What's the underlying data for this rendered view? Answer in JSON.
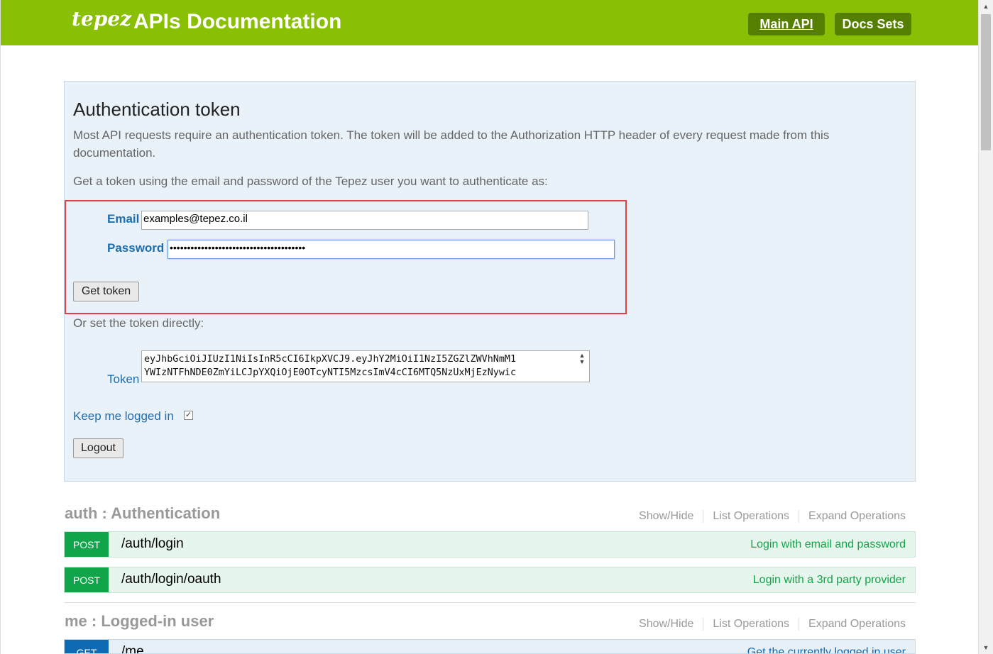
{
  "header": {
    "logo": "tepez",
    "title": "APIs Documentation",
    "main_api": "Main API",
    "docs_sets": "Docs Sets",
    "bg_color": "#89bf04"
  },
  "auth": {
    "title": "Authentication token",
    "description": "Most API requests require an authentication token. The token will be added to the Authorization HTTP header of every request made from this documentation.",
    "prompt": "Get a token using the email and password of the Tepez user you want to authenticate as:",
    "email_label": "Email",
    "email_value": "examples@tepez.co.il",
    "password_label": "Password",
    "password_value": "•••••••••••••••••••••••••••••••••••••••",
    "get_token": "Get token",
    "or_set": "Or set the token directly:",
    "token_label": "Token",
    "token_value": "eyJhbGciOiJIUzI1NiIsInR5cCI6IkpXVCJ9.eyJhY2MiOiI1NzI5ZGZlZWVhNmM1\nYWIzNTFhNDE0ZmYiLCJpYXQiOjE0OTcyNTI5MzcsImV4cCI6MTQ5NzUxMjEzNywic",
    "keep_logged": "Keep me logged in",
    "keep_checked": "✓",
    "logout": "Logout"
  },
  "sections": [
    {
      "title": "auth : Authentication",
      "links": [
        "Show/Hide",
        "List Operations",
        "Expand Operations"
      ],
      "operations": [
        {
          "method": "POST",
          "path": "/auth/login",
          "summary": "Login with email and password"
        },
        {
          "method": "POST",
          "path": "/auth/login/oauth",
          "summary": "Login with a 3rd party provider"
        }
      ]
    },
    {
      "title": "me : Logged-in user",
      "links": [
        "Show/Hide",
        "List Operations",
        "Expand Operations"
      ],
      "operations": [
        {
          "method": "GET",
          "path": "/me",
          "summary": "Get the currently logged in user"
        }
      ]
    }
  ]
}
